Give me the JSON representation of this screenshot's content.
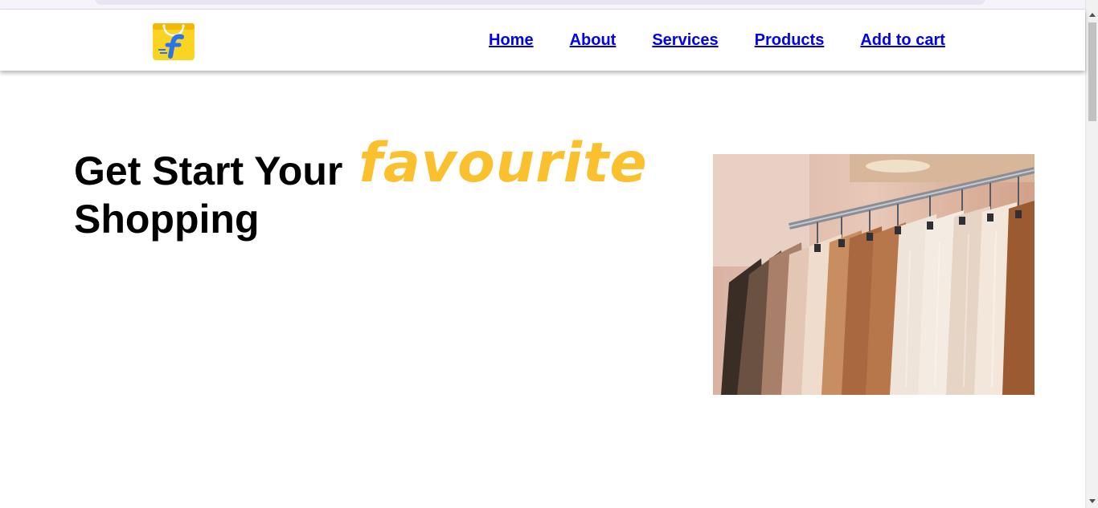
{
  "nav": {
    "logo_alt": "Flipkart logo",
    "links": [
      "Home",
      "About",
      "Services",
      "Products",
      "Add to cart"
    ]
  },
  "hero": {
    "title_start": "Get Start Your",
    "title_accent": "favourite",
    "title_end": "Shopping",
    "image_alt": "Clothes hanging on a rack"
  },
  "colors": {
    "accent": "#fbc02d",
    "link": "#0000ee",
    "logo_bag": "#f9d423",
    "logo_f": "#2874f0"
  },
  "icons": {
    "logo": "flipkart-bag-icon",
    "scroll_up": "triangle-up",
    "scroll_down": "triangle-down"
  }
}
